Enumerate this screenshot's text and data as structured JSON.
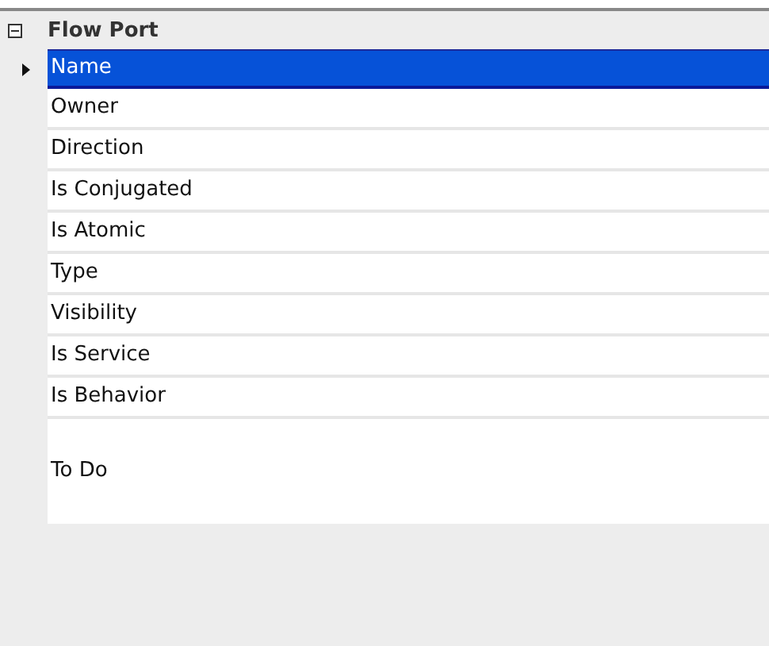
{
  "group": {
    "title": "Flow Port",
    "expanded": true
  },
  "properties": [
    {
      "label": "Name",
      "selected": true,
      "kind": "row"
    },
    {
      "label": "Owner",
      "selected": false,
      "kind": "row"
    },
    {
      "label": "Direction",
      "selected": false,
      "kind": "row"
    },
    {
      "label": "Is Conjugated",
      "selected": false,
      "kind": "row"
    },
    {
      "label": "Is Atomic",
      "selected": false,
      "kind": "row"
    },
    {
      "label": "Type",
      "selected": false,
      "kind": "row"
    },
    {
      "label": "Visibility",
      "selected": false,
      "kind": "row"
    },
    {
      "label": "Is Service",
      "selected": false,
      "kind": "row"
    },
    {
      "label": "Is Behavior",
      "selected": false,
      "kind": "row"
    },
    {
      "label": "To Do",
      "selected": false,
      "kind": "tall"
    }
  ]
}
